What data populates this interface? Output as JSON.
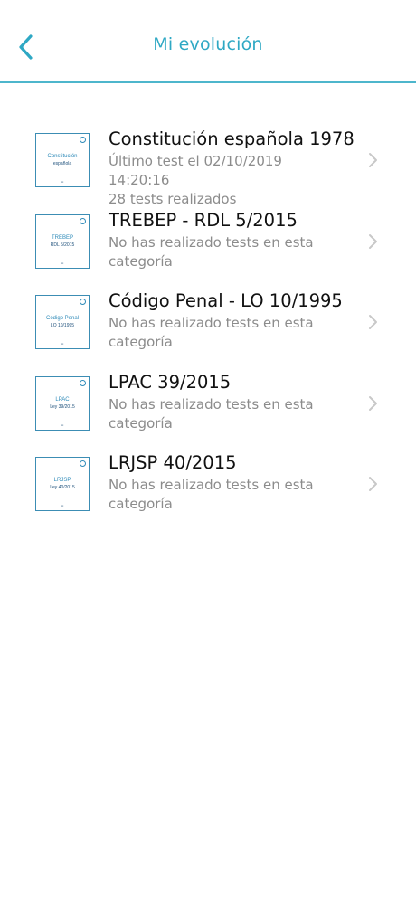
{
  "header": {
    "title": "Mi evolución",
    "back_icon": "chevron-left-icon"
  },
  "colors": {
    "accent": "#2ea8c4",
    "divider": "#4db6cc",
    "title_text": "#111111",
    "subtitle_text": "#8c8c8c",
    "chevron": "#c8c8c8"
  },
  "items": [
    {
      "title": "Constitución española 1978",
      "subtitle": "Último test el 02/10/2019 14:20:16\n28 tests realizados",
      "thumb_line1": "Constitución",
      "thumb_line2": "española",
      "chevron_icon": "chevron-right-icon"
    },
    {
      "title": "TREBEP - RDL 5/2015",
      "subtitle": "No has realizado tests en esta categoría",
      "thumb_line1": "TREBEP",
      "thumb_line2": "RDL 5/2015",
      "chevron_icon": "chevron-right-icon"
    },
    {
      "title": "Código Penal - LO 10/1995",
      "subtitle": "No has realizado tests en esta categoría",
      "thumb_line1": "Código Penal",
      "thumb_line2": "LO 10/1995",
      "chevron_icon": "chevron-right-icon"
    },
    {
      "title": "LPAC 39/2015",
      "subtitle": "No has realizado tests en esta categoría",
      "thumb_line1": "LPAC",
      "thumb_line2": "Ley 39/2015",
      "chevron_icon": "chevron-right-icon"
    },
    {
      "title": "LRJSP 40/2015",
      "subtitle": "No has realizado tests en esta categoría",
      "thumb_line1": "LRJSP",
      "thumb_line2": "Ley 40/2015",
      "chevron_icon": "chevron-right-icon"
    }
  ]
}
